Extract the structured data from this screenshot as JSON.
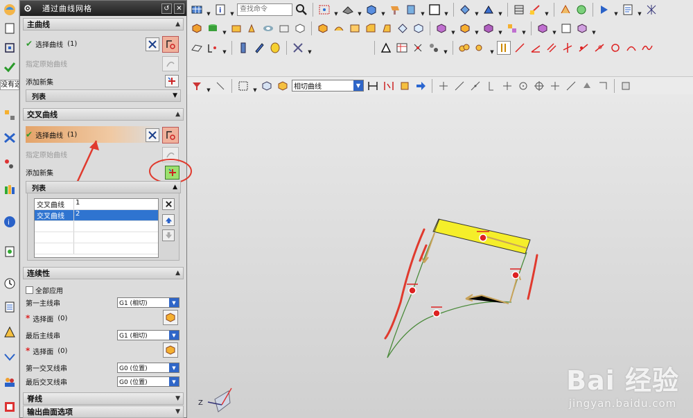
{
  "dialog": {
    "title": "通过曲线网格",
    "primary_section": {
      "title": "主曲线",
      "select_curve_label": "选择曲线",
      "select_curve_count": "(1)",
      "specify_origin_label": "指定原始曲线",
      "add_new_set_label": "添加新集",
      "list_label": "列表"
    },
    "cross_section": {
      "title": "交叉曲线",
      "select_curve_label": "选择曲线",
      "select_curve_count": "(1)",
      "specify_origin_label": "指定原始曲线",
      "add_new_set_label": "添加新集",
      "list_label": "列表",
      "list_rows": [
        {
          "name": "交叉曲线",
          "index": "1"
        },
        {
          "name": "交叉曲线",
          "index": "2"
        }
      ]
    },
    "continuity": {
      "title": "连续性",
      "apply_all_label": "全部应用",
      "first_primary_label": "第一主线串",
      "first_primary_value": "G1 (相切)",
      "select_face_label": "选择面",
      "select_face_count": "(0)",
      "last_primary_label": "最后主线串",
      "last_primary_value": "G1 (相切)",
      "select_face2_label": "选择面",
      "select_face2_count": "(0)",
      "first_cross_label": "第一交叉线串",
      "first_cross_value": "G0 (位置)",
      "last_cross_label": "最后交叉线串",
      "last_cross_value": "G0 (位置)"
    },
    "spine_section": {
      "title": "脊线"
    },
    "output_section": {
      "title": "输出曲面选项"
    }
  },
  "toolbar": {
    "search_placeholder": "查找命令",
    "curve_rule_value": "相切曲线"
  },
  "left_text": "没有选",
  "triad_label": "Z",
  "watermark": {
    "logo": "Bai 经验",
    "url": "jingyan.baidu.com"
  },
  "colors": {
    "highlight": "#e4a46a",
    "selected_row": "#2f74d0",
    "annotation_red": "#e03a2e",
    "surface_yellow": "#f5ee2a",
    "curve_green": "#4a8a3a",
    "vector_tan": "#c8a35a"
  }
}
